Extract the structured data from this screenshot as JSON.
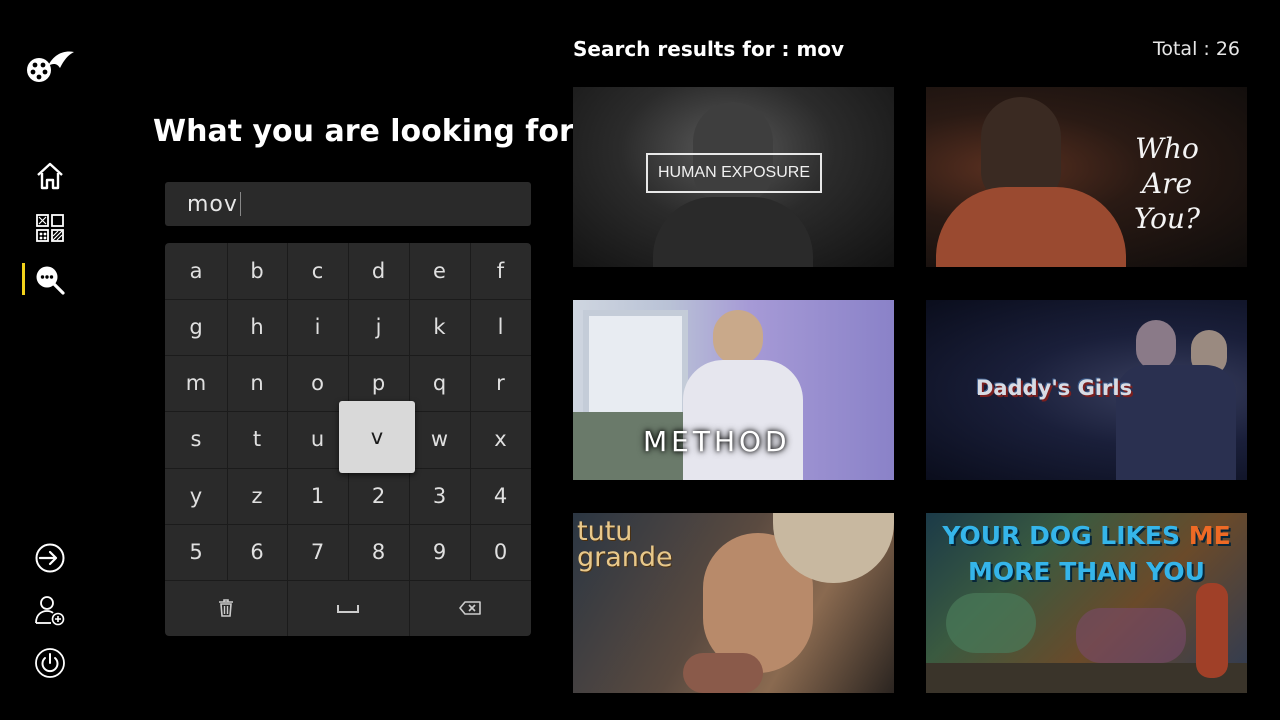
{
  "sidebar": {
    "logo_icon": "film-reel-logo-icon",
    "nav": [
      {
        "name": "home",
        "icon": "home-icon"
      },
      {
        "name": "categories",
        "icon": "grid-icon"
      },
      {
        "name": "search",
        "icon": "search-chat-icon",
        "active": true
      }
    ],
    "bottom": [
      {
        "name": "login",
        "icon": "login-icon"
      },
      {
        "name": "add-user",
        "icon": "add-user-icon"
      },
      {
        "name": "power",
        "icon": "power-icon"
      }
    ],
    "active_color": "#f2d21b"
  },
  "search": {
    "heading": "What you are looking for?",
    "query": "mov"
  },
  "keyboard": {
    "rows": [
      [
        "a",
        "b",
        "c",
        "d",
        "e",
        "f"
      ],
      [
        "g",
        "h",
        "i",
        "j",
        "k",
        "l"
      ],
      [
        "m",
        "n",
        "o",
        "p",
        "q",
        "r"
      ],
      [
        "s",
        "t",
        "u",
        "v",
        "w",
        "x"
      ],
      [
        "y",
        "z",
        "1",
        "2",
        "3",
        "4"
      ],
      [
        "5",
        "6",
        "7",
        "8",
        "9",
        "0"
      ]
    ],
    "highlighted": "v",
    "function_keys": [
      {
        "name": "clear",
        "icon": "trash-icon"
      },
      {
        "name": "space",
        "icon": "space-bar-icon"
      },
      {
        "name": "backspace",
        "icon": "backspace-icon"
      }
    ]
  },
  "results": {
    "title": "Search results for : mov",
    "total": "Total : 26",
    "items": [
      {
        "title_art": "HUMAN EXPOSURE"
      },
      {
        "title_art": "Who Are You?"
      },
      {
        "title_art": "METHOD"
      },
      {
        "title_art": "Daddy's Girls"
      },
      {
        "title_art": "tutu grande"
      },
      {
        "title_art_1": "YOUR DOG LIKES ",
        "title_art_2": "ME",
        "title_art_3": "MORE THAN YOU"
      }
    ]
  }
}
